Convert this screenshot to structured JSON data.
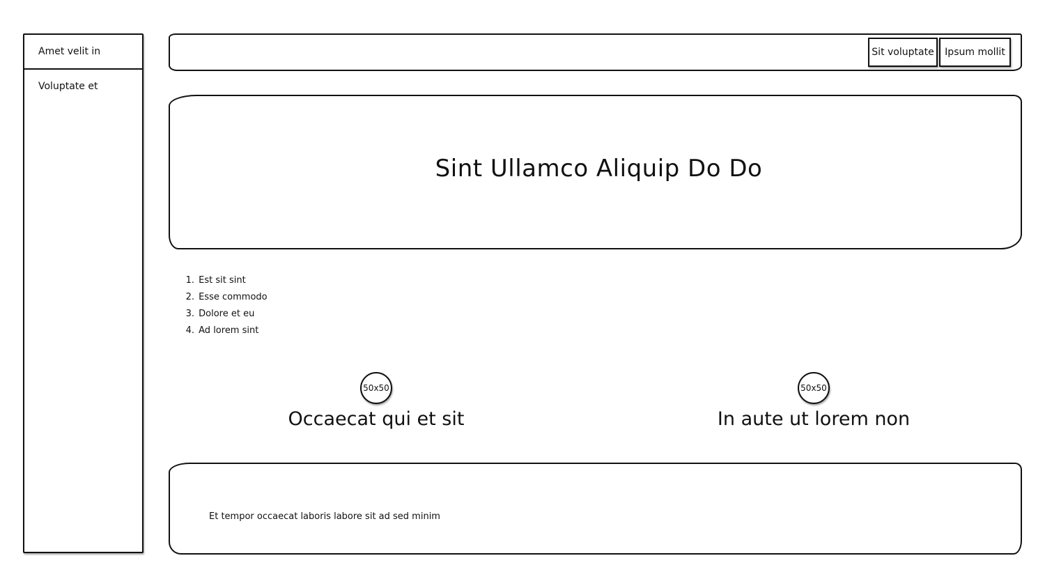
{
  "sidebar": {
    "items": [
      {
        "label": "Amet velit in"
      },
      {
        "label": "Voluptate et"
      }
    ]
  },
  "topbar": {
    "buttons": [
      {
        "label": "Sit voluptate"
      },
      {
        "label": "Ipsum mollit"
      }
    ]
  },
  "hero": {
    "title": "Sint Ullamco Aliquip Do Do"
  },
  "steps": [
    {
      "num": "1.",
      "label": "Est sit sint"
    },
    {
      "num": "2.",
      "label": "Esse commodo"
    },
    {
      "num": "3.",
      "label": "Dolore et eu"
    },
    {
      "num": "4.",
      "label": "Ad lorem sint"
    }
  ],
  "features": [
    {
      "image_label": "50x50",
      "title": "Occaecat qui et sit"
    },
    {
      "image_label": "50x50",
      "title": "In aute ut lorem non"
    }
  ],
  "footer": {
    "text": "Et tempor occaecat laboris labore sit ad sed minim"
  }
}
